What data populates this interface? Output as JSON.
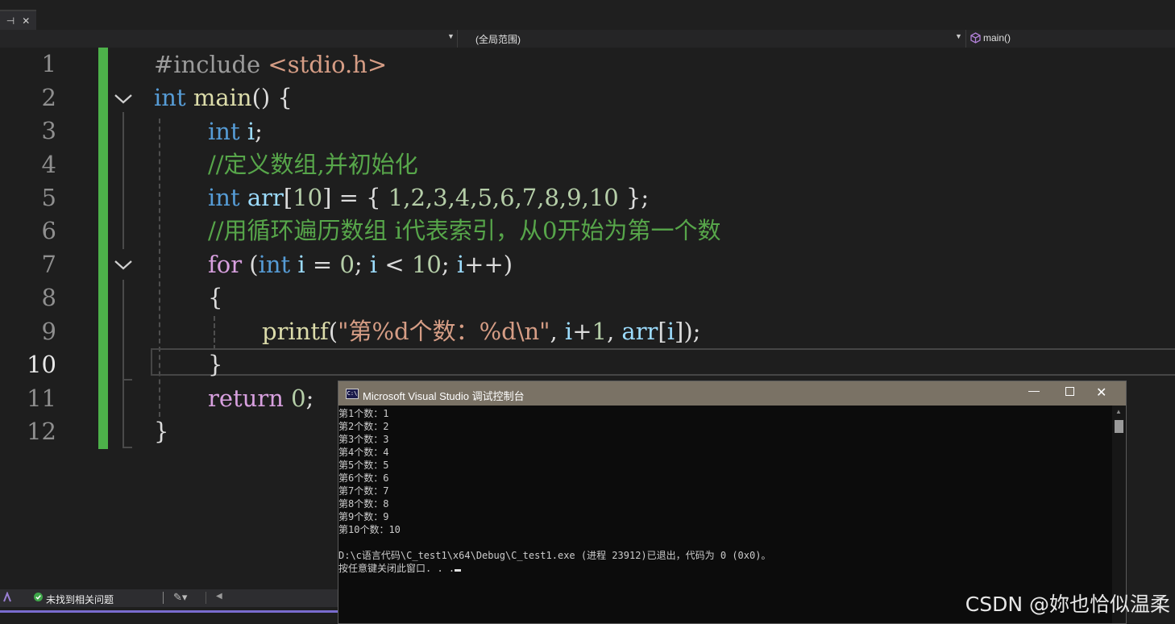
{
  "tab": {
    "pin_glyph": "⊣",
    "close_glyph": "✕"
  },
  "navbar": {
    "scope_label": "(全局范围)",
    "member_label": "main()"
  },
  "line_numbers": [
    "1",
    "2",
    "3",
    "4",
    "5",
    "6",
    "7",
    "8",
    "9",
    "10",
    "11",
    "12"
  ],
  "code": {
    "l1_pp": "#include ",
    "l1_inc": "<stdio.h>",
    "l2_kw": "int",
    "l2_fn": "main",
    "l2_rest": "() {",
    "l3_kw": "int",
    "l3_var": " i",
    "l3_rest": ";",
    "l4_comment": "//定义数组,并初始化",
    "l5_kw": "int",
    "l5_var": " arr",
    "l5_a": "[",
    "l5_n10": "10",
    "l5_b": "] = { ",
    "l5_vals": "1,2,3,4,5,6,7,8,9,10",
    "l5_end": " };",
    "l6_comment": "//用循环遍历数组 i代表索引，从0开始为第一个数",
    "l7_for": "for",
    "l7_a": " (",
    "l7_int": "int",
    "l7_i": " i",
    "l7_b": " = ",
    "l7_0": "0",
    "l7_c": "; ",
    "l7_i2": "i",
    "l7_d": " < ",
    "l7_10": "10",
    "l7_e": "; ",
    "l7_i3": "i",
    "l7_f": "++)",
    "l8": "{",
    "l9_fn": "printf",
    "l9_a": "(",
    "l9_str": "\"第%d个数：%d\\n\"",
    "l9_b": ", ",
    "l9_i": "i",
    "l9_c": "+",
    "l9_1": "1",
    "l9_d": ", ",
    "l9_arr": "arr",
    "l9_e": "[",
    "l9_i2": "i",
    "l9_f": "]);",
    "l10": "}",
    "l11_kw": "return",
    "l11_sp": " ",
    "l11_0": "0",
    "l11_end": ";",
    "l12": "}"
  },
  "status": {
    "issues": "未找到相关问题"
  },
  "console": {
    "title": "Microsoft Visual Studio 调试控制台",
    "app_icon": "C:\\",
    "lines": [
      "第1个数：1",
      "第2个数：2",
      "第3个数：3",
      "第4个数：4",
      "第5个数：5",
      "第6个数：6",
      "第7个数：7",
      "第8个数：8",
      "第9个数：9",
      "第10个数：10",
      "",
      "D:\\c语言代码\\C_test1\\x64\\Debug\\C_test1.exe (进程 23912)已退出，代码为 0 (0x0)。",
      "按任意键关闭此窗口. . ."
    ]
  },
  "watermark": "CSDN @妳也恰似温柔",
  "colors": {
    "change_bar": "#4db14a",
    "keyword": "#569cd6",
    "comment": "#57a64a",
    "string": "#d69d85",
    "console_title": "#7a7265"
  }
}
